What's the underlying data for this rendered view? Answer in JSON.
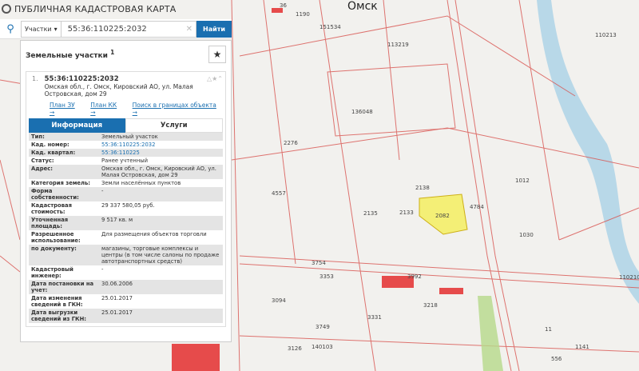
{
  "app": {
    "title": "ПУБЛИЧНАЯ КАДАСТРОВАЯ КАРТА"
  },
  "search": {
    "type": "Участки",
    "value": "55:36:110225:2032",
    "button": "Найти"
  },
  "panel": {
    "title": "Земельные участки",
    "count": "1",
    "result": {
      "index": "1.",
      "number": "55:36:110225:2032",
      "address": "Омская обл., г. Омск, Кировский АО, ул. Малая Островская, дом 29"
    },
    "links": [
      "План ЗУ →",
      "План КК →",
      "Поиск в границах объекта →"
    ],
    "tabs": [
      "Информация",
      "Услуги"
    ],
    "rows": [
      {
        "k": "Тип:",
        "v": "Земельный участок"
      },
      {
        "k": "Кад. номер:",
        "v": "55:36:110225:2032",
        "link": true
      },
      {
        "k": "Кад. квартал:",
        "v": "55:36:110225",
        "link": true
      },
      {
        "k": "Статус:",
        "v": "Ранее учтенный"
      },
      {
        "k": "Адрес:",
        "v": "Омская обл., г. Омск, Кировский АО, ул. Малая Островская, дом 29"
      },
      {
        "k": "Категория земель:",
        "v": "Земли населённых пунктов"
      },
      {
        "k": "Форма собственности:",
        "v": "-"
      },
      {
        "k": "Кадастровая стоимость:",
        "v": "29 337 580,05 руб."
      },
      {
        "k": "Уточненная площадь:",
        "v": "9 517 кв. м"
      },
      {
        "k": "Разрешенное использование:",
        "v": "Для размещения объектов торговли"
      },
      {
        "k": "по документу:",
        "v": "магазины, торговые комплексы и центры (в том числе салоны по продаже автотранспортных средств)"
      },
      {
        "k": "Кадастровый инженер:",
        "v": "-"
      },
      {
        "k": "Дата постановки на учет:",
        "v": "30.06.2006"
      },
      {
        "k": "Дата изменения сведений в ГКН:",
        "v": "25.01.2017"
      },
      {
        "k": "Дата выгрузки сведений из ГКН:",
        "v": "25.01.2017"
      }
    ]
  },
  "map": {
    "city": "Омск",
    "labels": [
      "36",
      "1190",
      "151534",
      "113219",
      "110213",
      "136048",
      "2276",
      "4557",
      "2138",
      "2135",
      "2133",
      "2082",
      "4784",
      "1012",
      "1030",
      "3754",
      "3353",
      "3992",
      "3094",
      "3749",
      "3126",
      "140103",
      "3331",
      "3218",
      "110210",
      "556",
      "11",
      "1141"
    ]
  }
}
